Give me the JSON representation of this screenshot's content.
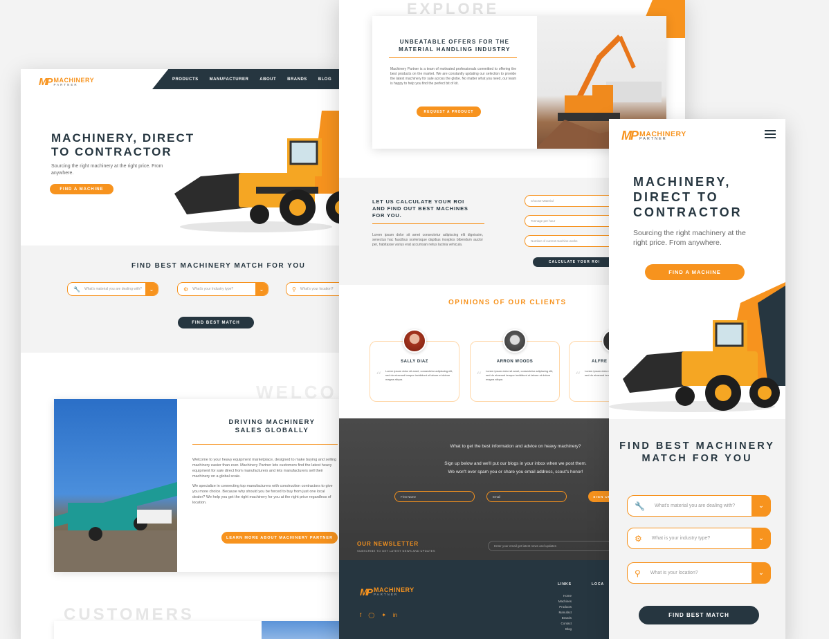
{
  "brand": {
    "mark": "MP",
    "name": "MACHINERY",
    "sub": "PARTNER"
  },
  "colors": {
    "accent": "#f7931e",
    "dark": "#263640"
  },
  "desktop": {
    "nav": [
      "PRODUCTS",
      "MANUFACTURER",
      "ABOUT",
      "BRANDS",
      "BLOG",
      "C"
    ],
    "hero_title": "MACHINERY, DIRECT TO CONTRACTOR",
    "hero_sub": "Sourcing the right machinery at the right price. From anywhere.",
    "find_btn": "FIND A MACHINE",
    "match_title": "FIND BEST MACHINERY MATCH FOR YOU",
    "select_material": "What's material you are dealing with?",
    "select_industry": "What's your Industry type?",
    "select_location": "What's your location?",
    "match_btn": "FIND BEST MATCH",
    "welcome_ghost": "WELCO",
    "drive_title": "DRIVING MACHINERY SALES GLOBALLY",
    "drive_p1": "Welcome to your heavy equipment marketplace, designed to make buying and selling machinery easier than ever. Machinery Partner lets customers find the latest heavy equipment for sale direct from manufacturers and lets manufacturers sell their machinery on a global scale.",
    "drive_p2": "We specialize in connecting top manufacturers with construction contractors to give you more choice. Because why should you be forced to buy from just one local dealer? We help you get the right machinery for you at the right price regardless of location.",
    "drive_btn": "LEARN MORE ABOUT MACHINERY PARTNER",
    "customers_ghost": "CUSTOMERS"
  },
  "middle": {
    "explore_ghost": "EXPLORE",
    "offer_title": "UNBEATABLE OFFERS FOR THE MATERIAL HANDLING INDUSTRY",
    "offer_p": "Machinery Partner is a team of motivated professionals committed to offering the best products on the market. We are constantly updating our selection to provide the latest machinery for sale across the globe. No matter what you need, our team is happy to help you find the perfect bit of kit.",
    "offer_btn": "REQUEST A PRODUCT",
    "roi_title": "LET US CALCULATE YOUR ROI AND FIND OUT BEST MACHINES FOR YOU.",
    "roi_p": "Lorem ipsum dolor sit amet consectetur adipiscing elit dignissim, senectus hac faucibus scelerisque dapibus inceptos bibendum auctor per, habitasse varius erat accumsan netus lacinia vehicula.",
    "roi_field1": "Choose Material",
    "roi_field2": "Tonnage per hour",
    "roi_field3": "Number of current machine works",
    "roi_btn": "CALCULATE YOUR ROI",
    "opinions_title": "OPINIONS OF OUR CLIENTS",
    "testimonials": [
      {
        "name": "SALLY DIAZ",
        "quote": "Lorem ipsum dolor sit amet, consectetur adipiscing elit, sed do eiusmod tempor incididunt ut labore et dolore magna aliqua."
      },
      {
        "name": "ARRON WOODS",
        "quote": "Lorem ipsum dolor sit amet, consectetur adipiscing elit, sed do eiusmod tempor incididunt ut labore et dolore magna aliqua."
      },
      {
        "name": "ALFRE",
        "quote": "Lorem ipsum dolor sit amet, consectetur adipiscing elit, sed do eiusmod tempor incididunt."
      }
    ],
    "nl_line1": "What to get the best information and advice on heavy machinery?",
    "nl_line2": "Sign up below and we'll put our blogs in your inbox when we post them.",
    "nl_line3": "We won't ever spam you or share you email address, scout's honor!",
    "nl_first": "First Name",
    "nl_email_field": "Email",
    "nl_signup": "SIGN UP",
    "nl_heading": "OUR NEWSLETTER",
    "nl_sub": "SUBSCRIBE TO GET LATEST NEWS AND UPDATES",
    "nl_email_placeholder": "Enter your email get latest news and updates",
    "footer_links_h": "LINKS",
    "footer_loc_h": "LOCA",
    "footer_links": [
      "Home",
      "Machines",
      "Products",
      "Manufact",
      "Brands",
      "Contact",
      "Blog"
    ]
  },
  "mobile": {
    "hero_title": "MACHINERY, DIRECT TO CONTRACTOR",
    "hero_sub": "Sourcing the right machinery at the right price. From anywhere.",
    "find_btn": "FIND A MACHINE",
    "match_title": "FIND BEST MACHINERY MATCH FOR YOU",
    "select_material": "What's material you are dealing with?",
    "select_industry": "What is your industry type?",
    "select_location": "What is your location?",
    "match_btn": "FIND BEST MATCH"
  }
}
